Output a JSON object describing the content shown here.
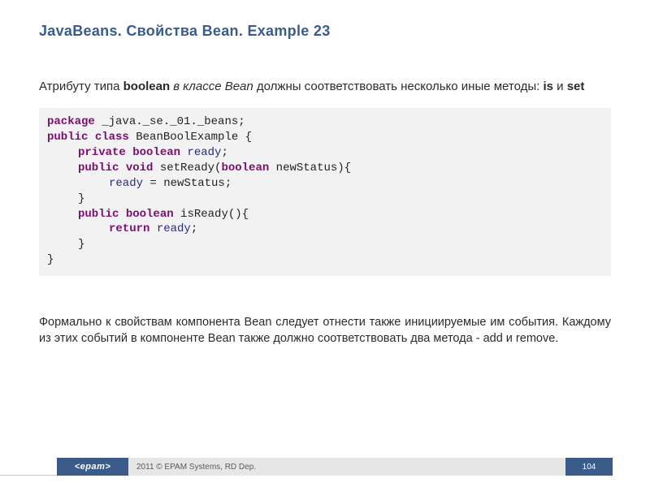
{
  "title": "JavaBeans. Свойства Bean. Example 23",
  "intro": {
    "pre": "Атрибуту типа ",
    "bool": "boolean",
    "mid_it": " в классе Bean",
    "mid2": " должны соответствовать несколько иные методы: ",
    "is": "is",
    "and": " и ",
    "set": "set"
  },
  "code": {
    "l1_kw": "package",
    "l1_rest": " _java._se._01._beans;",
    "l2_kw1": "public",
    "l2_kw2": "class",
    "l2_name": " BeanBoolExample ",
    "l2_brace": "{",
    "l3_kw1": "private",
    "l3_kw2": "boolean",
    "l3_var": " ready",
    "l3_semi": ";",
    "l4_kw1": "public",
    "l4_kw2": "void",
    "l4_name": " setReady(",
    "l4_kw3": "boolean",
    "l4_arg": " newStatus){",
    "l5_var": "ready",
    "l5_rest": " = newStatus;",
    "l6": "}",
    "l7_kw1": "public",
    "l7_kw2": "boolean",
    "l7_name": " isReady(){",
    "l8_kw": "return",
    "l8_var": " ready",
    "l8_semi": ";",
    "l9": "}",
    "l10": "}"
  },
  "outro": "Формально к свойствам компонента Bean следует отнести также инициируемые им события. Каждому из этих событий в компоненте Bean также должно соответствовать два метода - add и remove.",
  "footer": {
    "logo": "<epam>",
    "copyright": "2011 © EPAM Systems, RD Dep.",
    "page": "104"
  }
}
